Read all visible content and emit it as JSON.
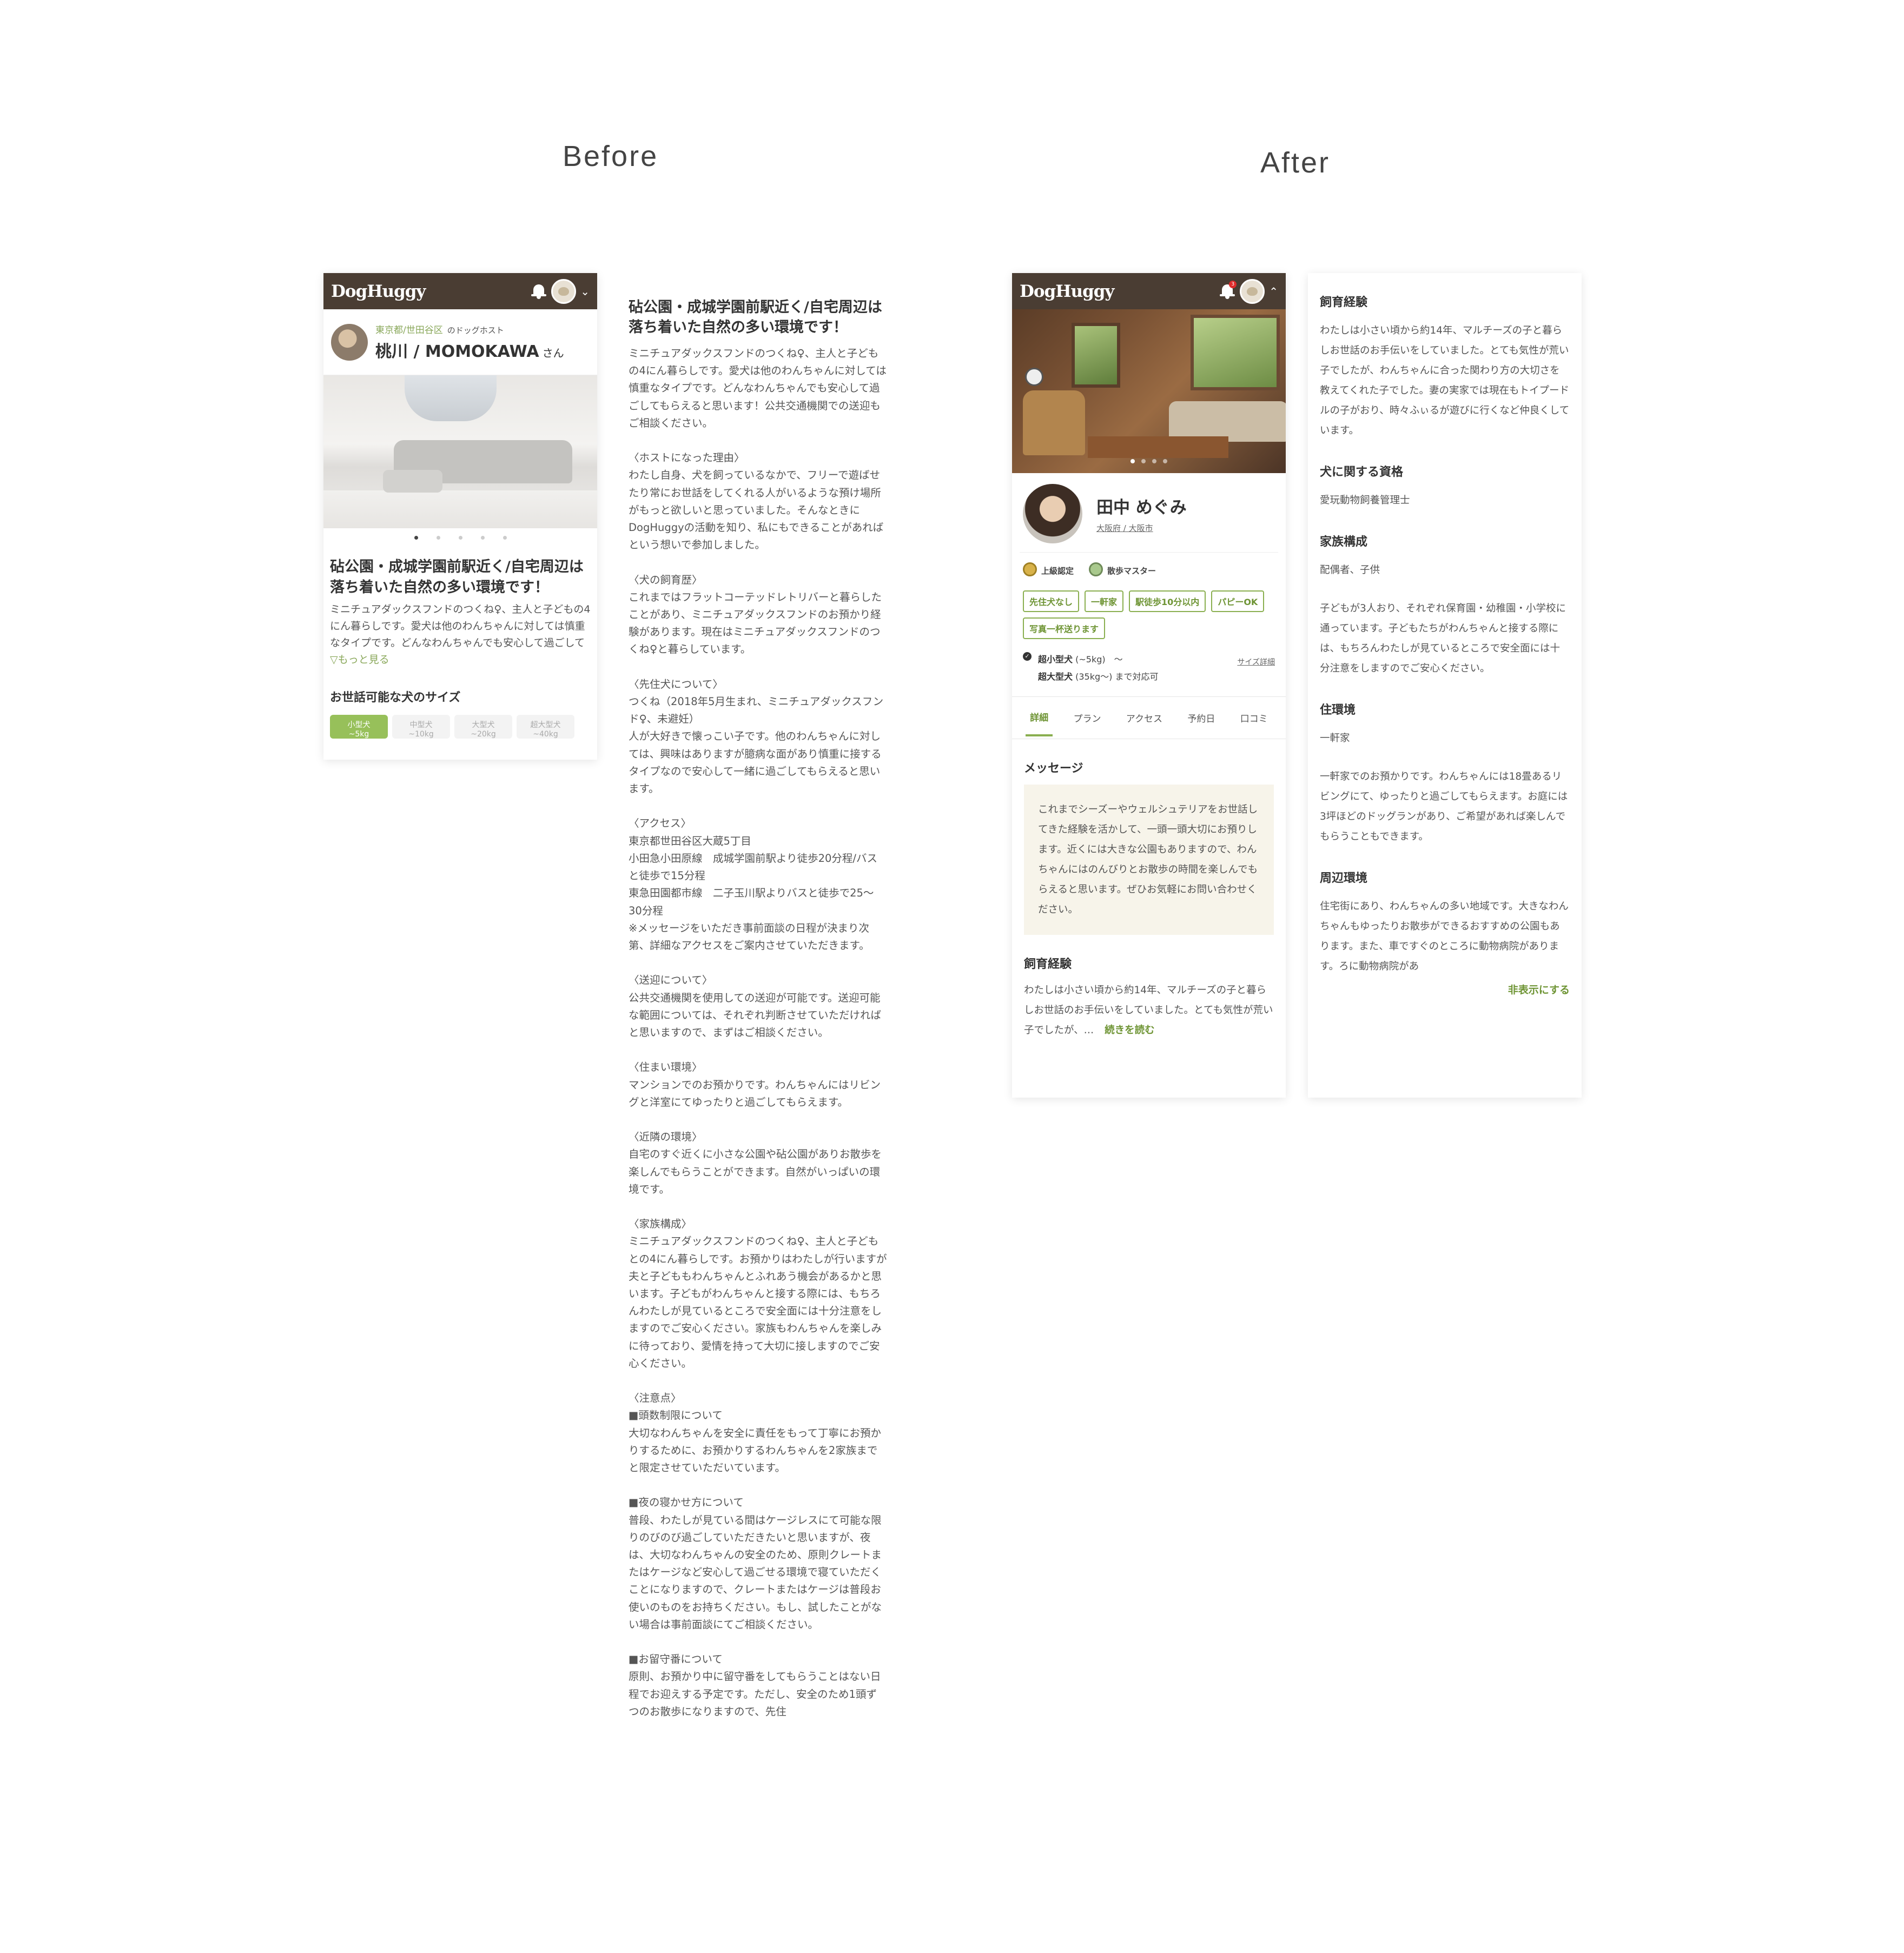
{
  "labels": {
    "before": "Before",
    "after": "After"
  },
  "app": {
    "logo": "DogHuggy",
    "notification_count": "3"
  },
  "before": {
    "host": {
      "area": "東京都/世田谷区",
      "role": "のドッグホスト",
      "name": "桃川 / MOMOKAWA",
      "suffix": "さん"
    },
    "carousel": {
      "count": 5,
      "active": 1
    },
    "title": "砧公園・成城学園前駅近く/自宅周辺は落ち着いた自然の多い環境です！",
    "intro": "ミニチュアダックスフンドのつくね♀、主人と子どもの4にん暮らしです。愛犬は他のわんちゃんに対しては慎重なタイプです。どんなわんちゃんでも安心して過ごしてもらえると思います！",
    "more": "▽もっと見る",
    "size_heading": "お世話可能な犬のサイズ",
    "size_tabs": [
      {
        "label": "小型犬",
        "sub": "~5kg",
        "active": true
      },
      {
        "label": "中型犬",
        "sub": "~10kg",
        "active": false
      },
      {
        "label": "大型犬",
        "sub": "~20kg",
        "active": false
      },
      {
        "label": "超大型犬",
        "sub": "~40kg",
        "active": false
      }
    ],
    "full_title": "砧公園・成城学園前駅近く/自宅周辺は落ち着いた自然の多い環境です！",
    "full_body": "ミニチュアダックスフンドのつくね♀、主人と子どもの4にん暮らしです。愛犬は他のわんちゃんに対しては慎重なタイプです。どんなわんちゃんでも安心して過ごしてもらえると思います！公共交通機関での送迎もご相談ください。\n\n〈ホストになった理由〉\nわたし自身、犬を飼っているなかで、フリーで遊ばせたり常にお世話をしてくれる人がいるような預け場所がもっと欲しいと思っていました。そんなときにDogHuggyの活動を知り、私にもできることがあればという想いで参加しました。\n\n〈犬の飼育歴〉\nこれまではフラットコーテッドレトリバーと暮らしたことがあり、ミニチュアダックスフンドのお預かり経験があります。現在はミニチュアダックスフンドのつくね♀と暮らしています。\n\n〈先住犬について〉\nつくね（2018年5月生まれ、ミニチュアダックスフンド♀、未避妊）\n人が大好きで懐っこい子です。他のわんちゃんに対しては、興味はありますが臆病な面があり慎重に接するタイプなので安心して一緒に過ごしてもらえると思います。\n\n〈アクセス〉\n東京都世田谷区大蔵5丁目\n小田急小田原線　成城学園前駅より徒歩20分程/バスと徒歩で15分程\n東急田園都市線　二子玉川駅よりバスと徒歩で25〜30分程\n※メッセージをいただき事前面談の日程が決まり次第、詳細なアクセスをご案内させていただきます。\n\n〈送迎について〉\n公共交通機関を使用しての送迎が可能です。送迎可能な範囲については、それぞれ判断させていただければと思いますので、まずはご相談ください。\n\n〈住まい環境〉\nマンションでのお預かりです。わんちゃんにはリビングと洋室にてゆったりと過ごしてもらえます。\n\n〈近隣の環境〉\n自宅のすぐ近くに小さな公園や砧公園がありお散歩を楽しんでもらうことができます。自然がいっぱいの環境です。\n\n〈家族構成〉\nミニチュアダックスフンドのつくね♀、主人と子どもとの4にん暮らしです。お預かりはわたしが行いますが夫と子どももわんちゃんとふれあう機会があるかと思います。子どもがわんちゃんと接する際には、もちろんわたしが見ているところで安全面には十分注意をしますのでご安心ください。家族もわんちゃんを楽しみに待っており、愛情を持って大切に接しますのでご安心ください。\n\n〈注意点〉\n■頭数制限について\n大切なわんちゃんを安全に責任をもって丁寧にお預かりするために、お預かりするわんちゃんを2家族までと限定させていただいています。\n\n■夜の寝かせ方について\n普段、わたしが見ている間はケージレスにて可能な限りのびのび過ごしていただきたいと思いますが、夜は、大切なわんちゃんの安全のため、原則クレートまたはケージなど安心して過ごせる環境で寝ていただくことになりますので、クレートまたはケージは普段お使いのものをお持ちください。もし、試したことがない場合は事前面談にてご相談ください。\n\n■お留守番について\n原則、お預かり中に留守番をしてもらうことはない日程でお迎えする予定です。ただし、安全のため1頭ずつのお散歩になりますので、先住"
  },
  "after": {
    "carousel": {
      "count": 4,
      "active": 1
    },
    "profile": {
      "name": "田中 めぐみ",
      "area": "大阪府 / 大阪市"
    },
    "badges": [
      "上級認定",
      "散歩マスター"
    ],
    "tags": [
      "先住犬なし",
      "一軒家",
      "駅徒歩10分以内",
      "パピーOK",
      "写真一杯送ります"
    ],
    "sizes": {
      "line1_bold": "超小型犬",
      "line1_rest": "(~5kg)　〜",
      "line2_bold": "超大型犬",
      "line2_rest": "(35kg〜) まで対応可",
      "detail_link": "サイズ詳細"
    },
    "tabs": [
      "詳細",
      "プラン",
      "アクセス",
      "予約日",
      "口コミ"
    ],
    "active_tab": "詳細",
    "message_heading": "メッセージ",
    "message": "これまでシーズーやウェルシュテリアをお世話してきた経験を活かして、一頭一頭大切にお預りします。近くには大きな公園もありますので、わんちゃんにはのんびりとお散歩の時間を楽しんでもらえると思います。ぜひお気軽にお問い合わせください。",
    "experience_heading": "飼育経験",
    "experience_preview": "わたしは小さい頃から約14年、マルチーズの子と暮らしお世話のお手伝いをしていました。とても気性が荒い子でしたが、…",
    "read_more": "続きを読む",
    "panel": {
      "experience_heading": "飼育経験",
      "experience": "わたしは小さい頃から約14年、マルチーズの子と暮らしお世話のお手伝いをしていました。とても気性が荒い子でしたが、わんちゃんに合った関わり方の大切さを教えてくれた子でした。妻の実家では現在もトイプードルの子がおり、時々ふぃるが遊びに行くなど仲良くしています。",
      "qualification_heading": "犬に関する資格",
      "qualification": "愛玩動物飼養管理士",
      "family_heading": "家族構成",
      "family": "配偶者、子供",
      "family_note": "子どもが3人おり、それぞれ保育園・幼稚園・小学校に通っています。子どもたちがわんちゃんと接する際には、もちろんわたしが見ているところで安全面には十分注意をしますのでご安心ください。",
      "house_heading": "住環境",
      "house": "一軒家",
      "house_note": "一軒家でのお預かりです。わんちゃんには18畳あるリビングにて、ゆったりと過ごしてもらえます。お庭には3坪ほどのドッグランがあり、ご希望があれば楽しんでもらうこともできます。",
      "area_heading": "周辺環境",
      "area": "住宅街にあり、わんちゃんの多い地域です。大きなわんちゃんもゆったりお散歩ができるおすすめの公園もあります。また、車ですぐのところに動物病院があります。ろに動物病院があ",
      "hide_link": "非表示にする"
    }
  }
}
